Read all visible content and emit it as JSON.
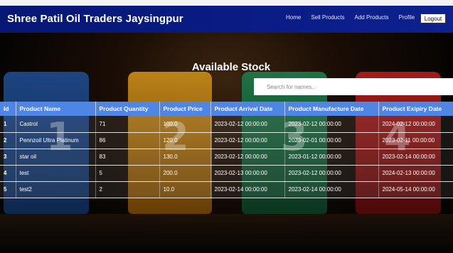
{
  "navbar": {
    "brand": "Shree Patil Oil Traders Jaysingpur",
    "links": [
      "Home",
      "Sell Products",
      "Add Products",
      "Profile"
    ],
    "logout_label": "Logout"
  },
  "main": {
    "heading": "Available Stock",
    "search_placeholder": "Search for names.."
  },
  "table": {
    "headers": [
      "Id",
      "Product Name",
      "Product Quantity",
      "Product Price",
      "Product Arrival Date",
      "Product Manufacture Date",
      "Product Exipiry Date"
    ],
    "rows": [
      [
        "1",
        "Castrol",
        "71",
        "100.0",
        "2023-02-12 00:00:00",
        "2023-02-12 00:00:00",
        "2024-02-12 00:00:00"
      ],
      [
        "2",
        "Pennzoil Ultra Platinum",
        "86",
        "120.0",
        "2023-02-12 00:00:00",
        "2023-02-01 00:00:00",
        "2023-02-11 00:00:00"
      ],
      [
        "3",
        "star oil",
        "83",
        "130.0",
        "2023-02-12 00:00:00",
        "2023-01-12 00:00:00",
        "2023-02-14 00:00:00"
      ],
      [
        "4",
        "test",
        "5",
        "200.0",
        "2023-02-13 00:00:00",
        "2023-02-12 00:00:00",
        "2024-02-13 00:00:00"
      ],
      [
        "5",
        "test2",
        "2",
        "10.0",
        "2023-02-14 00:00:00",
        "2023-02-14 00:00:00",
        "2024-05-14 00:00:00"
      ]
    ]
  },
  "background": {
    "bottle_labels": [
      "1",
      "2",
      "3",
      "4"
    ]
  }
}
